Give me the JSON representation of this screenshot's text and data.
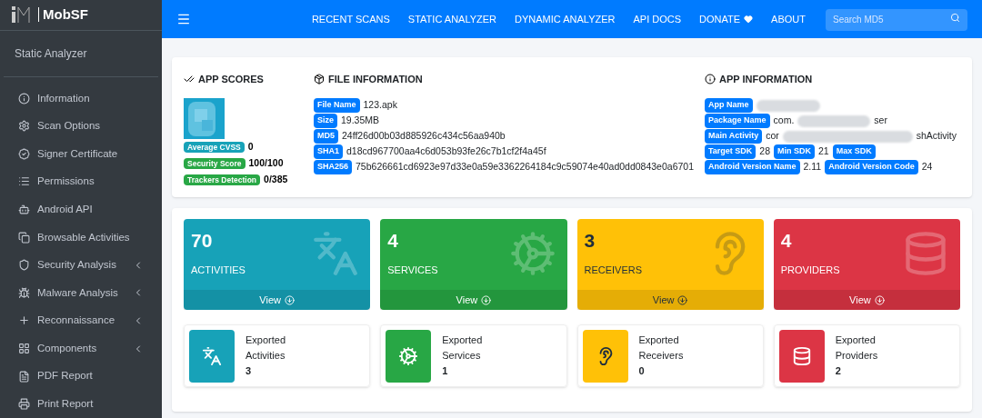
{
  "brand": {
    "name": "MobSF"
  },
  "sidebar": {
    "header": "Static Analyzer",
    "items": [
      {
        "label": "Information",
        "expandable": false
      },
      {
        "label": "Scan Options",
        "expandable": false
      },
      {
        "label": "Signer Certificate",
        "expandable": false
      },
      {
        "label": "Permissions",
        "expandable": false
      },
      {
        "label": "Android API",
        "expandable": false
      },
      {
        "label": "Browsable Activities",
        "expandable": false
      },
      {
        "label": "Security Analysis",
        "expandable": true
      },
      {
        "label": "Malware Analysis",
        "expandable": true
      },
      {
        "label": "Reconnaissance",
        "expandable": true
      },
      {
        "label": "Components",
        "expandable": true
      },
      {
        "label": "PDF Report",
        "expandable": false
      },
      {
        "label": "Print Report",
        "expandable": false
      }
    ]
  },
  "nav": {
    "links": [
      "RECENT SCANS",
      "STATIC ANALYZER",
      "DYNAMIC ANALYZER",
      "API DOCS",
      "DONATE",
      "ABOUT"
    ],
    "search": {
      "placeholder": "Search MD5"
    }
  },
  "app_scores": {
    "title": "APP SCORES",
    "items": [
      {
        "label": "Average CVSS",
        "value": "0",
        "color": "#17a2b8"
      },
      {
        "label": "Security Score",
        "value": "100/100",
        "color": "#28a745"
      },
      {
        "label": "Trackers Detection",
        "value": "0/385",
        "color": "#28a745"
      }
    ]
  },
  "file_information": {
    "title": "FILE INFORMATION",
    "lines": [
      {
        "fields": [
          {
            "label": "File Name",
            "value": "123.apk"
          }
        ]
      },
      {
        "fields": [
          {
            "label": "Size",
            "value": "19.35MB"
          }
        ]
      },
      {
        "fields": [
          {
            "label": "MD5",
            "value": "24ff26d00b03d885926c434c56aa940b"
          }
        ]
      },
      {
        "fields": [
          {
            "label": "SHA1",
            "value": "d18cd967700aa4c6d053b93fe26c7b1cf2f4a45f"
          }
        ]
      },
      {
        "fields": [
          {
            "label": "SHA256",
            "value": "75b626661cd6923e97d33e0a59e3362264184c9c59074e40ad0dd0843e0a6701"
          }
        ]
      }
    ]
  },
  "app_information": {
    "title": "APP INFORMATION",
    "lines": [
      {
        "fields": [
          {
            "label": "App Name",
            "redacted": true
          }
        ]
      },
      {
        "fields": [
          {
            "label": "Package Name",
            "value": "com.",
            "redacted": true,
            "value_end": "ser"
          }
        ]
      },
      {
        "fields": [
          {
            "label": "Main Activity",
            "value": "cor",
            "redacted": true,
            "value_end": "shActivity"
          }
        ]
      },
      {
        "fields": [
          {
            "label": "Target SDK",
            "value": "28"
          },
          {
            "label": "Min SDK",
            "value": "21"
          },
          {
            "label": "Max SDK"
          }
        ]
      },
      {
        "fields": [
          {
            "label": "Android Version Name",
            "value": "2.11"
          },
          {
            "label": "Android Version Code",
            "value": "24"
          }
        ]
      }
    ]
  },
  "components": [
    {
      "count": "70",
      "label": "ACTIVITIES",
      "link": "View",
      "color": "#17a2b8",
      "exported_label": [
        "Exported",
        "Activities"
      ],
      "exported_count": "3"
    },
    {
      "count": "4",
      "label": "SERVICES",
      "link": "View",
      "color": "#28a745",
      "exported_label": [
        "Exported",
        "Services"
      ],
      "exported_count": "1"
    },
    {
      "count": "3",
      "label": "RECEIVERS",
      "link": "View",
      "color": "#ffc107",
      "exported_label": [
        "Exported",
        "Receivers"
      ],
      "exported_count": "0"
    },
    {
      "count": "4",
      "label": "PROVIDERS",
      "link": "View",
      "color": "#dc3545",
      "exported_label": [
        "Exported",
        "Providers"
      ],
      "exported_count": "2"
    }
  ]
}
